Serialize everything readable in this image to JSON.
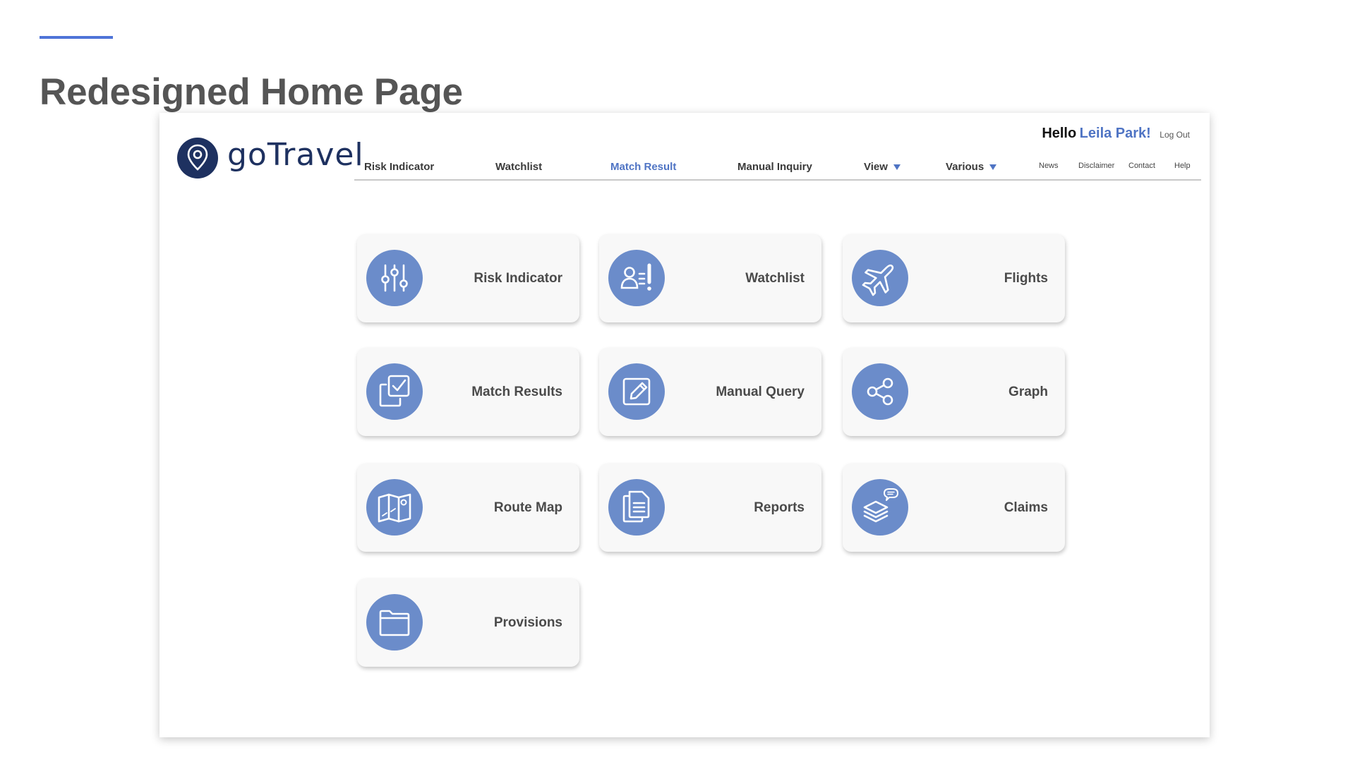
{
  "slide": {
    "title": "Redesigned Home Page",
    "accent_color": "#4f74d8"
  },
  "app": {
    "brand": "goTravel",
    "brand_color": "#1e3160",
    "accent_color": "#4f74c4",
    "icon_circle_color": "#6b8cca",
    "greeting": {
      "hello": "Hello",
      "name": "Leila Park!",
      "logout": "Log Out"
    },
    "nav": {
      "main": [
        {
          "label": "Risk Indicator"
        },
        {
          "label": "Watchlist"
        },
        {
          "label": "Match Result",
          "active": true
        },
        {
          "label": "Manual Inquiry"
        },
        {
          "label": "View",
          "dropdown": true
        },
        {
          "label": "Various",
          "dropdown": true
        }
      ],
      "secondary": [
        {
          "label": "News"
        },
        {
          "label": "Disclaimer"
        },
        {
          "label": "Contact"
        },
        {
          "label": "Help"
        }
      ]
    },
    "tiles": [
      {
        "label": "Risk Indicator",
        "icon": "sliders-icon"
      },
      {
        "label": "Watchlist",
        "icon": "person-alert-icon"
      },
      {
        "label": "Flights",
        "icon": "airplane-icon"
      },
      {
        "label": "Match Results",
        "icon": "copy-check-icon"
      },
      {
        "label": "Manual Query",
        "icon": "edit-icon"
      },
      {
        "label": "Graph",
        "icon": "share-icon"
      },
      {
        "label": "Route Map",
        "icon": "map-icon"
      },
      {
        "label": "Reports",
        "icon": "document-icon"
      },
      {
        "label": "Claims",
        "icon": "layers-chat-icon"
      },
      {
        "label": "Provisions",
        "icon": "folder-icon"
      }
    ]
  }
}
